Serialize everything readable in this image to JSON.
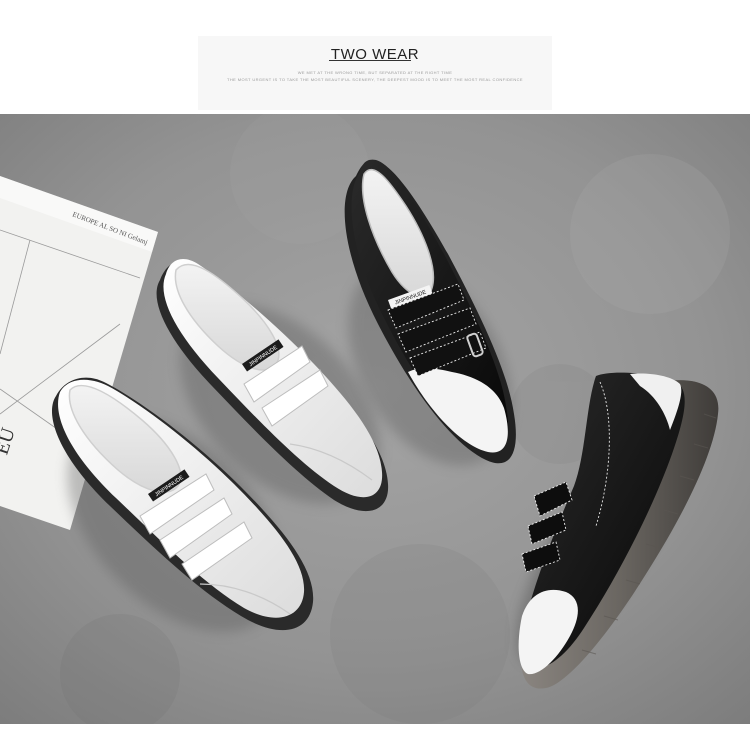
{
  "header": {
    "title": "TWO WEAR",
    "subtitle_line1": "WE MET AT THE WRONG TIME, BUT SEPARATED AT THE RIGHT TIME",
    "subtitle_line2": "THE MOST URGENT IS TO TAKE THE MOST BEAUTIFUL SCENERY, THE DEEPEST MOOD IS TO MEET THE MOST REAL CONFIDENCE"
  },
  "catalog": {
    "line1": "EUROPE AL SO NI Gelamj",
    "corner_text": "EU"
  },
  "shoes": {
    "tag_text": "JINPINNUDE"
  },
  "colors": {
    "background_surface": "#8f8f8f",
    "leather_white": "#f4f4f4",
    "leather_black": "#141414",
    "sole_dark": "#2b2b2b",
    "sole_translucent": "#6e6b66"
  }
}
